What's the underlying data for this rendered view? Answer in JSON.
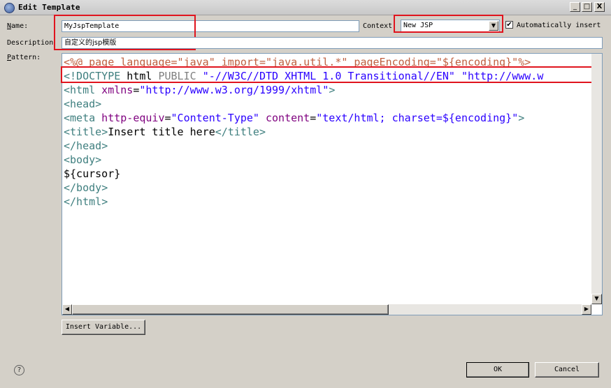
{
  "window": {
    "title": "Edit Template",
    "minimize": "_",
    "maximize": "□",
    "close": "X"
  },
  "form": {
    "name_label_pre": "",
    "name_label_u": "N",
    "name_label_post": "ame:",
    "name_value": "MyJspTemplate",
    "context_label": "Context",
    "context_value": "New JSP",
    "auto_insert_label": "Automatically insert",
    "auto_insert_checked": true,
    "description_label": "Description",
    "description_value": "自定义的jsp模版",
    "pattern_label_u": "P",
    "pattern_label_post": "attern:"
  },
  "pattern_lines": [
    "<%@ page language=\"java\" import=\"java.util.*\" pageEncoding=\"${encoding}\"%>",
    "<!DOCTYPE html PUBLIC \"-//W3C//DTD XHTML 1.0 Transitional//EN\" \"http://www.w",
    "<html xmlns=\"http://www.w3.org/1999/xhtml\">",
    "<head>",
    "<meta http-equiv=\"Content-Type\" content=\"text/html; charset=${encoding}\">",
    "<title>Insert title here</title>",
    "</head>",
    "<body>",
    "${cursor}",
    "</body>",
    "</html>"
  ],
  "buttons": {
    "insert_variable": "Insert Variable...",
    "ok": "OK",
    "cancel": "Cancel",
    "help": "?"
  },
  "colors": {
    "highlight_red": "#e0141e",
    "tag": "#3f7f7f",
    "attr": "#7f007f",
    "string": "#2a00ff"
  }
}
